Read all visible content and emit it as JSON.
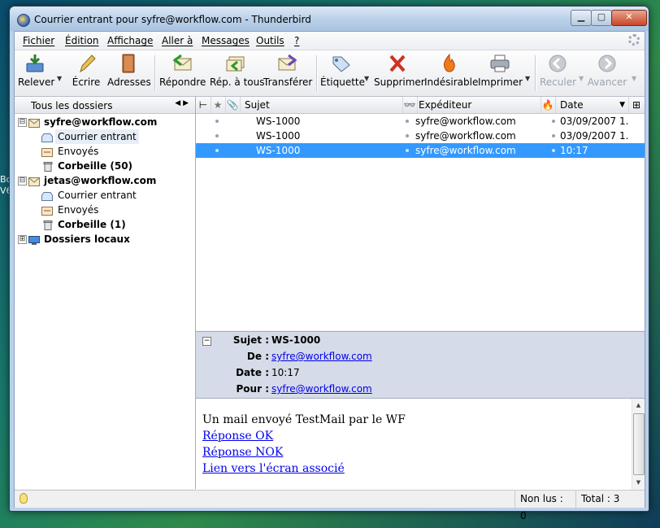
{
  "window": {
    "title": "Courrier entrant pour syfre@workflow.com - Thunderbird"
  },
  "desktop": {
    "partial_text_1": "Bc",
    "partial_text_2": "V6"
  },
  "menubar": {
    "items": [
      "Fichier",
      "Édition",
      "Affichage",
      "Aller à",
      "Messages",
      "Outils",
      "?"
    ]
  },
  "toolbar": {
    "buttons": [
      {
        "label": "Relever",
        "icon": "get-mail-icon"
      },
      {
        "label": "Écrire",
        "icon": "write-icon"
      },
      {
        "label": "Adresses",
        "icon": "address-book-icon"
      },
      {
        "label": "Répondre",
        "icon": "reply-icon"
      },
      {
        "label": "Rép. à tous",
        "icon": "reply-all-icon"
      },
      {
        "label": "Transférer",
        "icon": "forward-icon"
      },
      {
        "label": "Étiquette",
        "icon": "tag-icon"
      },
      {
        "label": "Supprimer",
        "icon": "delete-icon"
      },
      {
        "label": "Indésirable",
        "icon": "junk-icon"
      },
      {
        "label": "Imprimer",
        "icon": "print-icon"
      },
      {
        "label": "Reculer",
        "icon": "back-icon",
        "disabled": true
      },
      {
        "label": "Avancer",
        "icon": "forward-nav-icon",
        "disabled": true
      }
    ]
  },
  "folders": {
    "header": "Tous les dossiers",
    "items": [
      {
        "label": "syfre@workflow.com",
        "level": 0,
        "bold": true,
        "twisty": "⊟",
        "icon": "account-icon"
      },
      {
        "label": "Courrier entrant",
        "level": 1,
        "bold": false,
        "icon": "inbox-icon",
        "selected": true
      },
      {
        "label": "Envoyés",
        "level": 1,
        "bold": false,
        "icon": "sent-icon"
      },
      {
        "label": "Corbeille (50)",
        "level": 1,
        "bold": true,
        "icon": "trash-icon"
      },
      {
        "label": "jetas@workflow.com",
        "level": 0,
        "bold": true,
        "twisty": "⊟",
        "icon": "account-icon"
      },
      {
        "label": "Courrier entrant",
        "level": 1,
        "bold": false,
        "icon": "inbox-icon"
      },
      {
        "label": "Envoyés",
        "level": 1,
        "bold": false,
        "icon": "sent-icon"
      },
      {
        "label": "Corbeille (1)",
        "level": 1,
        "bold": true,
        "icon": "trash-icon"
      },
      {
        "label": "Dossiers locaux",
        "level": 0,
        "bold": true,
        "twisty": "⊞",
        "icon": "local-folders-icon"
      }
    ]
  },
  "threads": {
    "columns": {
      "subject": "Sujet",
      "sender": "Expéditeur",
      "date": "Date"
    },
    "rows": [
      {
        "subject": "WS-1000",
        "sender": "syfre@workflow.com",
        "date": "03/09/2007 1...",
        "selected": false
      },
      {
        "subject": "WS-1000",
        "sender": "syfre@workflow.com",
        "date": "03/09/2007 1...",
        "selected": false
      },
      {
        "subject": "WS-1000",
        "sender": "syfre@workflow.com",
        "date": "10:17",
        "selected": true
      }
    ]
  },
  "message_header": {
    "subject_label": "Sujet :",
    "subject": "WS-1000",
    "from_label": "De :",
    "from": "syfre@workflow.com",
    "date_label": "Date :",
    "date": "10:17",
    "to_label": "Pour :",
    "to": "syfre@workflow.com"
  },
  "message_body": {
    "line1": "Un mail envoyé TestMail par le WF",
    "link1": "Réponse OK",
    "link2": "Réponse NOK",
    "link3": "Lien vers l'écran associé"
  },
  "status": {
    "unread": "Non lus : 0",
    "total": "Total : 3"
  }
}
